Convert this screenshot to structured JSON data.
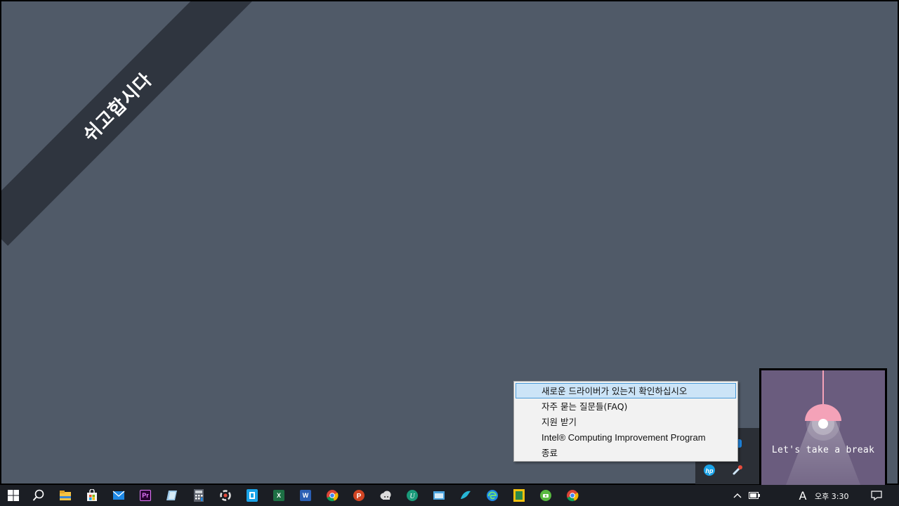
{
  "desktop": {
    "ribbon_text": "쉬고합시다",
    "background_color": "#505a68",
    "ribbon_color": "#2f353f"
  },
  "context_menu": {
    "items": [
      {
        "label": "새로운 드라이버가 있는지 확인하십시오",
        "highlighted": true
      },
      {
        "label": "자주 묻는 질문들(FAQ)",
        "highlighted": false
      },
      {
        "label": "지원 받기",
        "highlighted": false
      },
      {
        "label": "Intel® Computing Improvement Program",
        "highlighted": false
      },
      {
        "label": "종료",
        "highlighted": false
      }
    ]
  },
  "tray_overflow": {
    "icons": [
      "intel-driver-icon",
      "hp-icon",
      "hp-support-icon"
    ]
  },
  "break_popup": {
    "text": "Let's take a break",
    "background_color": "#6a5c7e",
    "lamp_color": "#f4a2b8"
  },
  "taskbar": {
    "apps": [
      "start-icon",
      "search-icon",
      "file-explorer-icon",
      "store-icon",
      "mail-icon",
      "premiere-icon",
      "notes-icon",
      "calculator-icon",
      "recorder-icon",
      "app-blue-icon",
      "excel-icon",
      "word-icon",
      "chrome-icon",
      "powerpoint-icon",
      "app-cloud-icon",
      "app-u-icon",
      "app-window-icon",
      "app-bird-icon",
      "edge-icon",
      "app-yellow-icon",
      "app-green-icon",
      "chrome-icon"
    ],
    "tray": {
      "ime": "A",
      "clock": "오후 3:30"
    }
  }
}
